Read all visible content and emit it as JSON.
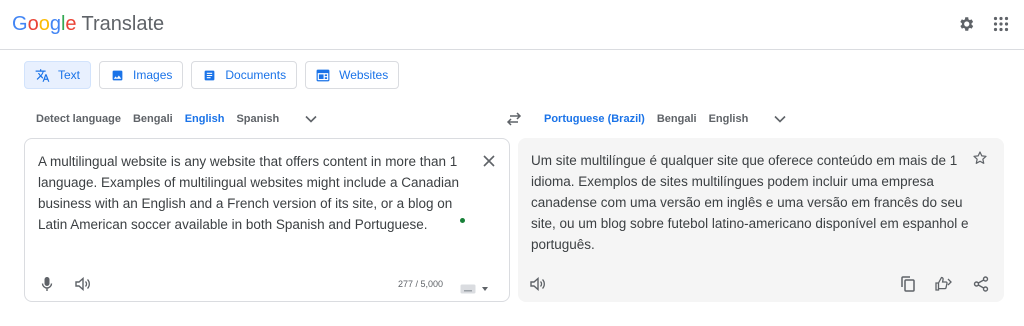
{
  "app": {
    "logo_letters": [
      "G",
      "o",
      "o",
      "g",
      "l",
      "e"
    ],
    "product": "Translate"
  },
  "header": {
    "icons": [
      "gear-icon",
      "apps-grid-icon"
    ]
  },
  "modes": [
    {
      "label": "Text",
      "icon": "translate-icon",
      "active": true
    },
    {
      "label": "Images",
      "icon": "image-icon",
      "active": false
    },
    {
      "label": "Documents",
      "icon": "document-icon",
      "active": false
    },
    {
      "label": "Websites",
      "icon": "website-icon",
      "active": false
    }
  ],
  "source_languages": {
    "items": [
      "Detect language",
      "Bengali",
      "English",
      "Spanish"
    ],
    "selected": "English"
  },
  "target_languages": {
    "items": [
      "Portuguese (Brazil)",
      "Bengali",
      "English"
    ],
    "selected": "Portuguese (Brazil)"
  },
  "source": {
    "text": "A multilingual website is any website that offers content in more than 1 language. Examples of multilingual websites might include a Canadian business with an English and a French version of its site, or a blog on Latin American soccer available in both Spanish and Portuguese.",
    "char_count": "277 / 5,000"
  },
  "target": {
    "text": "Um site multilíngue é qualquer site que oferece conteúdo em mais de 1 idioma. Exemplos de sites multilíngues podem incluir uma empresa canadense com uma versão em inglês e uma versão em francês do seu site, ou um blog sobre futebol latino-americano disponível em espanhol e português."
  },
  "colors": {
    "accent": "#1a73e8",
    "border": "#dadce0",
    "icon": "#5f6368",
    "panel_bg": "#f5f5f5",
    "active_bg": "#e8f0fe",
    "dot": "#188038"
  }
}
